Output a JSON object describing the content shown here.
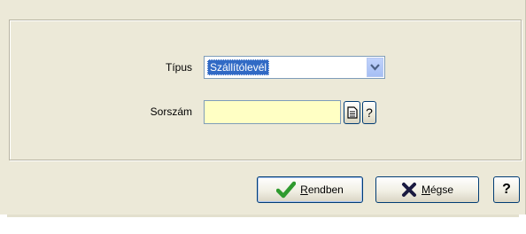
{
  "form": {
    "type_label": "Típus",
    "type_value": "Szállítólevél",
    "serial_label": "Sorszám",
    "serial_value": "",
    "help_small": "?"
  },
  "buttons": {
    "ok_mnemonic": "R",
    "ok_rest": "endben",
    "cancel_mnemonic": "M",
    "cancel_rest": "égse",
    "help": "?"
  },
  "colors": {
    "dialog_bg": "#ece9d8",
    "highlight": "#316ac5",
    "input_bg": "#ffffc4",
    "ok_icon": "#2f9a2f",
    "cancel_icon": "#1a1a40"
  },
  "icons": [
    "dropdown-arrow-icon",
    "document-icon",
    "checkmark-icon",
    "cross-icon"
  ]
}
